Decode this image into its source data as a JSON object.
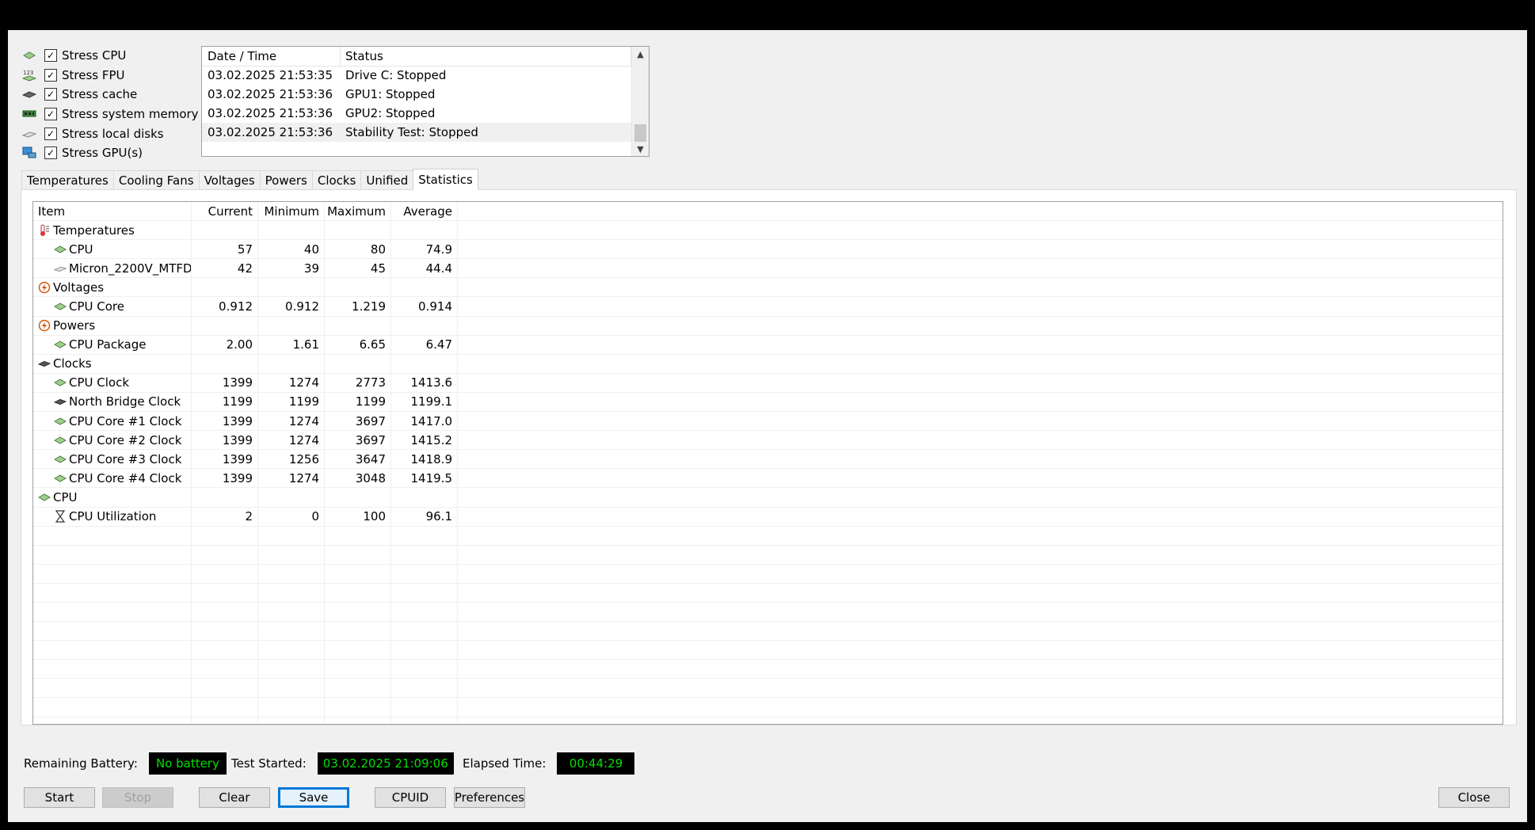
{
  "stress_options": [
    {
      "label": "Stress CPU",
      "checked": true,
      "icon": "cpu-chip-icon"
    },
    {
      "label": "Stress FPU",
      "checked": true,
      "icon": "fpu-123-icon"
    },
    {
      "label": "Stress cache",
      "checked": true,
      "icon": "cache-icon"
    },
    {
      "label": "Stress system memory",
      "checked": true,
      "icon": "memory-module-icon"
    },
    {
      "label": "Stress local disks",
      "checked": true,
      "icon": "disk-drive-icon"
    },
    {
      "label": "Stress GPU(s)",
      "checked": true,
      "icon": "gpu-monitor-icon"
    }
  ],
  "log": {
    "headers": [
      "Date / Time",
      "Status"
    ],
    "rows": [
      [
        "03.02.2025 21:53:35",
        "Drive C: Stopped"
      ],
      [
        "03.02.2025 21:53:36",
        "GPU1: Stopped"
      ],
      [
        "03.02.2025 21:53:36",
        "GPU2: Stopped"
      ],
      [
        "03.02.2025 21:53:36",
        "Stability Test: Stopped"
      ]
    ]
  },
  "tabs": [
    "Temperatures",
    "Cooling Fans",
    "Voltages",
    "Powers",
    "Clocks",
    "Unified",
    "Statistics"
  ],
  "active_tab": "Statistics",
  "stats": {
    "headers": [
      "Item",
      "Current",
      "Minimum",
      "Maximum",
      "Average"
    ],
    "rows": [
      {
        "label": "Temperatures",
        "group": true,
        "icon": "thermometer-icon",
        "values": [
          "",
          "",
          "",
          ""
        ]
      },
      {
        "label": "CPU",
        "group": false,
        "icon": "cpu-chip-icon",
        "values": [
          "57",
          "40",
          "80",
          "74.9"
        ]
      },
      {
        "label": "Micron_2200V_MTFD...",
        "group": false,
        "icon": "disk-drive-icon",
        "values": [
          "42",
          "39",
          "45",
          "44.4"
        ]
      },
      {
        "label": "Voltages",
        "group": true,
        "icon": "voltage-icon",
        "values": [
          "",
          "",
          "",
          ""
        ]
      },
      {
        "label": "CPU Core",
        "group": false,
        "icon": "cpu-chip-icon",
        "values": [
          "0.912",
          "0.912",
          "1.219",
          "0.914"
        ]
      },
      {
        "label": "Powers",
        "group": true,
        "icon": "power-icon",
        "values": [
          "",
          "",
          "",
          ""
        ]
      },
      {
        "label": "CPU Package",
        "group": false,
        "icon": "cpu-chip-icon",
        "values": [
          "2.00",
          "1.61",
          "6.65",
          "6.47"
        ]
      },
      {
        "label": "Clocks",
        "group": true,
        "icon": "clock-chip-icon",
        "values": [
          "",
          "",
          "",
          ""
        ]
      },
      {
        "label": "CPU Clock",
        "group": false,
        "icon": "cpu-chip-icon",
        "values": [
          "1399",
          "1274",
          "2773",
          "1413.6"
        ]
      },
      {
        "label": "North Bridge Clock",
        "group": false,
        "icon": "northbridge-chip-icon",
        "values": [
          "1199",
          "1199",
          "1199",
          "1199.1"
        ]
      },
      {
        "label": "CPU Core #1 Clock",
        "group": false,
        "icon": "cpu-chip-icon",
        "values": [
          "1399",
          "1274",
          "3697",
          "1417.0"
        ]
      },
      {
        "label": "CPU Core #2 Clock",
        "group": false,
        "icon": "cpu-chip-icon",
        "values": [
          "1399",
          "1274",
          "3697",
          "1415.2"
        ]
      },
      {
        "label": "CPU Core #3 Clock",
        "group": false,
        "icon": "cpu-chip-icon",
        "values": [
          "1399",
          "1256",
          "3647",
          "1418.9"
        ]
      },
      {
        "label": "CPU Core #4 Clock",
        "group": false,
        "icon": "cpu-chip-icon",
        "values": [
          "1399",
          "1274",
          "3048",
          "1419.5"
        ]
      },
      {
        "label": "CPU",
        "group": true,
        "icon": "cpu-chip-icon",
        "values": [
          "",
          "",
          "",
          ""
        ]
      },
      {
        "label": "CPU Utilization",
        "group": false,
        "icon": "hourglass-icon",
        "values": [
          "2",
          "0",
          "100",
          "96.1"
        ]
      }
    ]
  },
  "status": {
    "battery_label": "Remaining Battery:",
    "battery_value": "No battery",
    "started_label": "Test Started:",
    "started_value": "03.02.2025 21:09:06",
    "elapsed_label": "Elapsed Time:",
    "elapsed_value": "00:44:29"
  },
  "buttons": {
    "start": "Start",
    "stop": "Stop",
    "clear": "Clear",
    "save": "Save",
    "cpuid": "CPUID",
    "preferences": "Preferences",
    "close": "Close"
  },
  "colors": {
    "lcd_bg": "#000000",
    "lcd_text": "#00e000",
    "focus": "#0078d7"
  }
}
